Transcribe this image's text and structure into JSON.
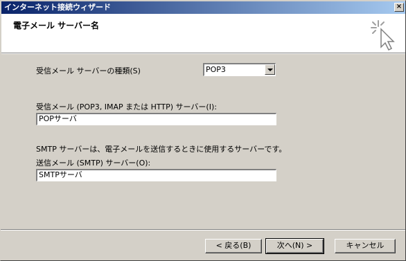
{
  "window": {
    "title": "インターネット接続ウィザード",
    "close_glyph": "×"
  },
  "header": {
    "heading": "電子メール サーバー名"
  },
  "form": {
    "incoming_type_label": "受信メール サーバーの種類(S)",
    "incoming_type_value": "POP3",
    "incoming_server_label": "受信メール (POP3, IMAP または HTTP) サーバー(I):",
    "incoming_server_value": "POPサーバ",
    "smtp_note": "SMTP サーバーは、電子メールを送信するときに使用するサーバーです。",
    "outgoing_server_label": "送信メール (SMTP) サーバー(O):",
    "outgoing_server_value": "SMTPサーバ"
  },
  "buttons": {
    "back": "< 戻る(B)",
    "next": "次へ(N) >",
    "cancel": "キャンセル"
  }
}
